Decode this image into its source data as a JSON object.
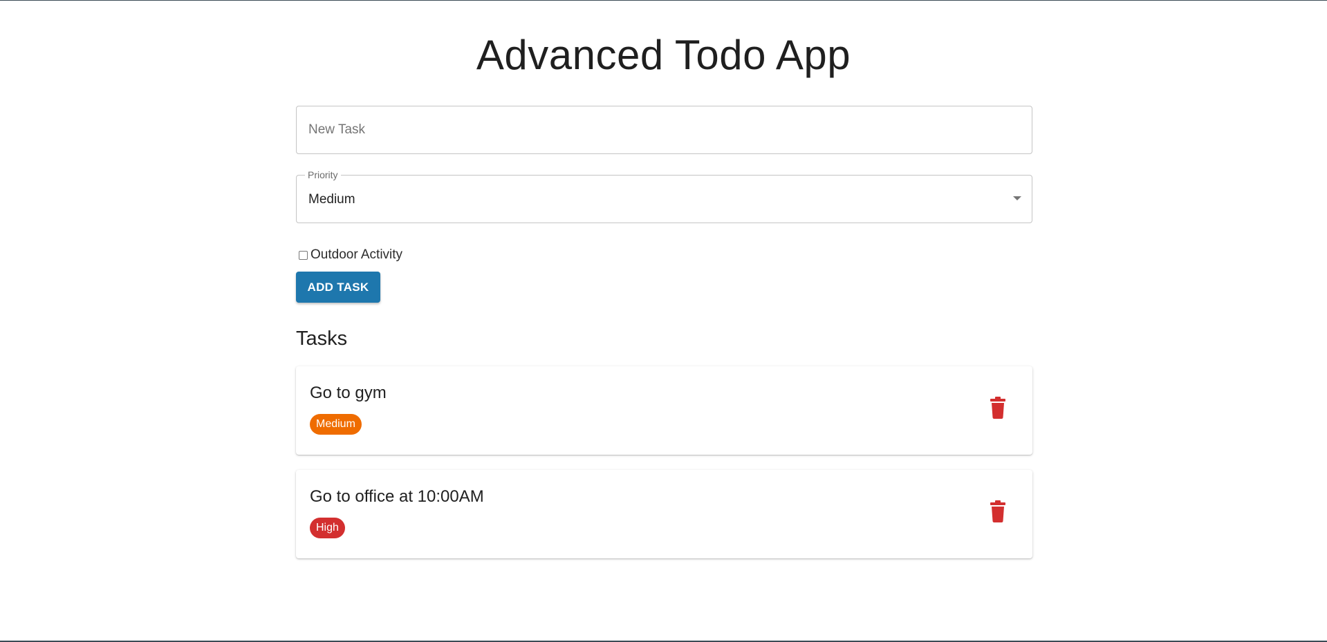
{
  "app": {
    "title": "Advanced Todo App"
  },
  "form": {
    "task_input": {
      "placeholder": "New Task",
      "value": ""
    },
    "priority_select": {
      "label": "Priority",
      "selected": "Medium"
    },
    "outdoor_checkbox": {
      "label": "Outdoor Activity",
      "checked": false
    },
    "add_button_label": "ADD TASK"
  },
  "tasks_section": {
    "heading": "Tasks",
    "items": [
      {
        "title": "Go to gym",
        "priority": "Medium",
        "priority_color": "#ef6c00",
        "delete_icon": "trash-icon"
      },
      {
        "title": "Go to office at 10:00AM",
        "priority": "High",
        "priority_color": "#d32f2f",
        "delete_icon": "trash-icon"
      }
    ]
  },
  "colors": {
    "primary": "#1e77ad",
    "delete": "#d32f2f"
  }
}
